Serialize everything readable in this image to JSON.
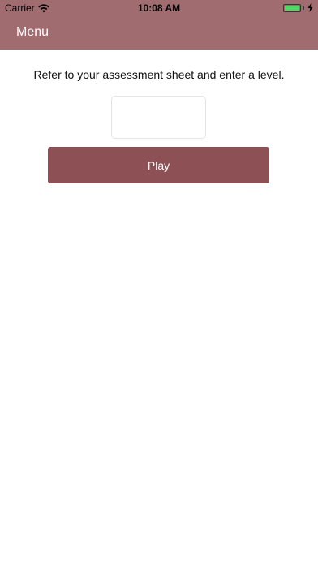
{
  "status_bar": {
    "carrier": "Carrier",
    "time": "10:08 AM",
    "battery_level": 1.0,
    "icons": [
      "wifi-icon",
      "battery-icon",
      "charging-bolt-icon"
    ]
  },
  "nav": {
    "menu_label": "Menu"
  },
  "main": {
    "instruction": "Refer to your assessment sheet and enter a level.",
    "level_input_value": "",
    "level_input_placeholder": "",
    "play_label": "Play"
  },
  "colors": {
    "header_bg": "#a06c70",
    "play_button_bg": "#8c5055",
    "battery_fill": "#4cd964"
  }
}
